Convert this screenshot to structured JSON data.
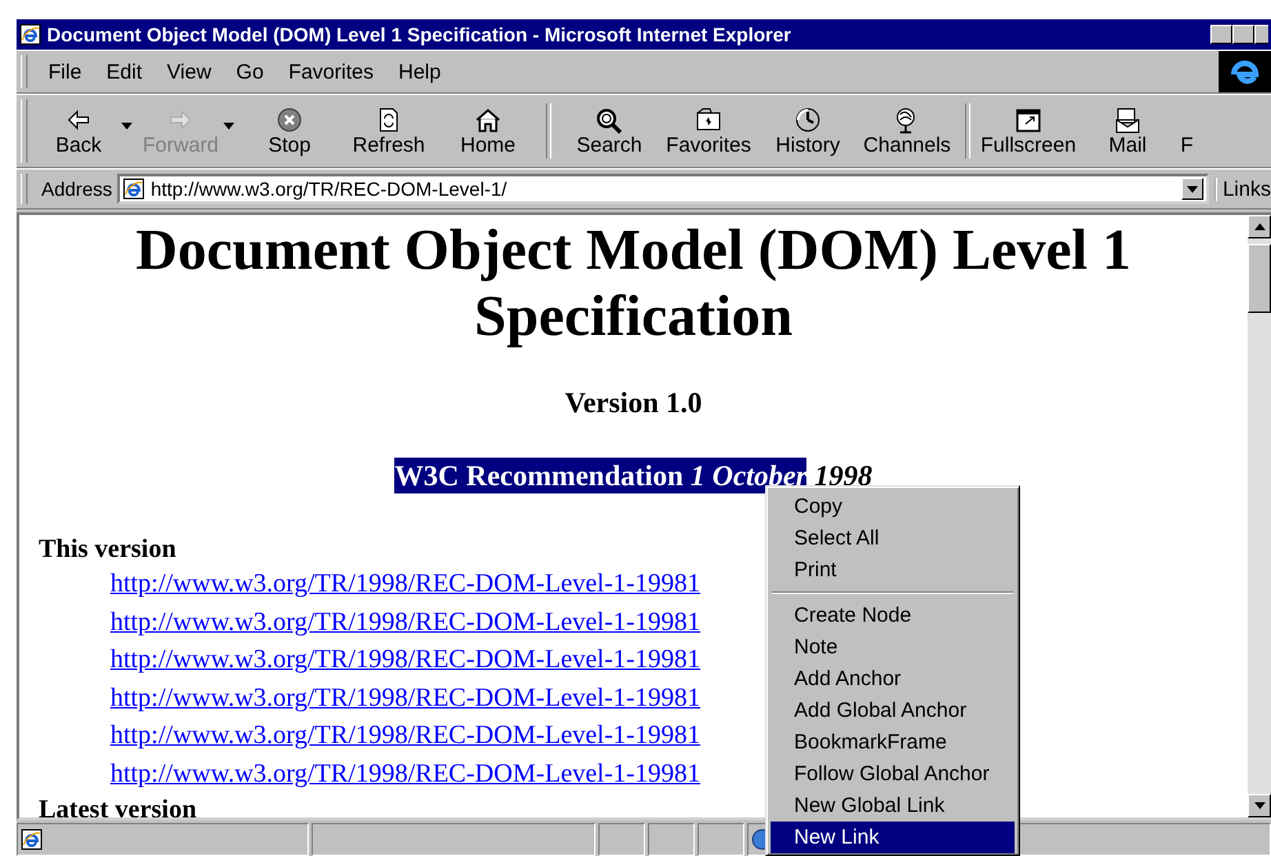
{
  "window": {
    "title": "Document Object Model (DOM) Level 1 Specification - Microsoft Internet Explorer"
  },
  "menu_bar": [
    {
      "label": "File"
    },
    {
      "label": "Edit"
    },
    {
      "label": "View"
    },
    {
      "label": "Go"
    },
    {
      "label": "Favorites"
    },
    {
      "label": "Help"
    }
  ],
  "toolbar": {
    "groups": [
      [
        {
          "label": "Back",
          "disabled": false,
          "dropdown": true
        },
        {
          "label": "Forward",
          "disabled": true,
          "dropdown": true
        },
        {
          "label": "Stop",
          "disabled": false,
          "dropdown": false
        },
        {
          "label": "Refresh",
          "disabled": false,
          "dropdown": false
        },
        {
          "label": "Home",
          "disabled": false,
          "dropdown": false
        }
      ],
      [
        {
          "label": "Search",
          "disabled": false,
          "dropdown": false
        },
        {
          "label": "Favorites",
          "disabled": false,
          "dropdown": false
        },
        {
          "label": "History",
          "disabled": false,
          "dropdown": false
        },
        {
          "label": "Channels",
          "disabled": false,
          "dropdown": false
        }
      ],
      [
        {
          "label": "Fullscreen",
          "disabled": false,
          "dropdown": false
        },
        {
          "label": "Mail",
          "disabled": false,
          "dropdown": false
        },
        {
          "label": "F",
          "disabled": false,
          "dropdown": false
        }
      ]
    ]
  },
  "address_bar": {
    "label": "Address",
    "value": "http://www.w3.org/TR/REC-DOM-Level-1/",
    "links_label": "Links"
  },
  "document": {
    "title": "Document Object Model (DOM) Level 1 Specification",
    "version": "Version 1.0",
    "status_line": [
      {
        "text": "W3C Recommendation ",
        "italic": false,
        "selected": true
      },
      {
        "text": "1 October",
        "italic": true,
        "selected": true
      },
      {
        "text": "1998",
        "italic": true,
        "selected": false
      }
    ],
    "sections": [
      {
        "heading": "This version",
        "links": [
          "http://www.w3.org/TR/1998/REC-DOM-Level-1-19981",
          "http://www.w3.org/TR/1998/REC-DOM-Level-1-19981",
          "http://www.w3.org/TR/1998/REC-DOM-Level-1-19981",
          "http://www.w3.org/TR/1998/REC-DOM-Level-1-19981",
          "http://www.w3.org/TR/1998/REC-DOM-Level-1-19981",
          "http://www.w3.org/TR/1998/REC-DOM-Level-1-19981"
        ]
      },
      {
        "heading": "Latest version"
      }
    ]
  },
  "context_menu": {
    "groups": [
      [
        {
          "label": "Copy",
          "selected": false
        },
        {
          "label": "Select All",
          "selected": false
        },
        {
          "label": "Print",
          "selected": false
        }
      ],
      [
        {
          "label": "Create Node",
          "selected": false
        },
        {
          "label": "Note",
          "selected": false
        },
        {
          "label": "Add Anchor",
          "selected": false
        },
        {
          "label": "Add Global Anchor",
          "selected": false
        },
        {
          "label": "BookmarkFrame",
          "selected": false
        },
        {
          "label": "Follow Global Anchor",
          "selected": false
        },
        {
          "label": "New Global Link",
          "selected": false
        },
        {
          "label": "New Link",
          "selected": true
        }
      ]
    ]
  }
}
